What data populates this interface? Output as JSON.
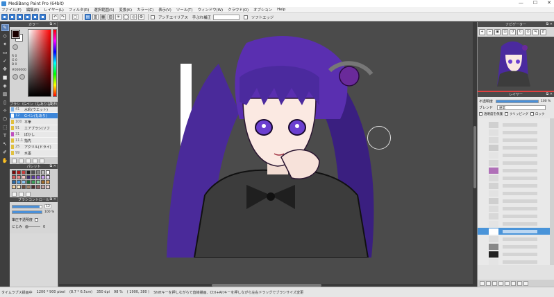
{
  "window": {
    "title": "MediBang Paint Pro (64bit)",
    "controls": [
      "—",
      "☐",
      "✕"
    ]
  },
  "menu": [
    "ファイル(F)",
    "編集(E)",
    "レイヤー(L)",
    "フィルタ(R)",
    "選択範囲(S)",
    "変換(K)",
    "カラー(C)",
    "表示(V)",
    "ツール(T)",
    "ウィンドウ(W)",
    "クラウド(O)",
    "オプション",
    "Help"
  ],
  "toolbar": {
    "antialias_label": "アンチエイリアス",
    "stabilizer_label": "手ぶれ補正",
    "soft_edge_label": "ソフトエッジ"
  },
  "panels": {
    "color_title": "カラー",
    "brush_title": "ブラシ（Gペン（もありもの））",
    "palette_title": "パレット",
    "brush_control_title": "ブラシコントロール",
    "navigator_title": "ナビゲーター",
    "layer_title": "レイヤー"
  },
  "color": {
    "fg": "#1a0000",
    "bg": "#ffffff",
    "rgb_lines": [
      "R 0",
      "G 0",
      "B 0"
    ],
    "hex": "#000000"
  },
  "brushes": [
    {
      "size": "41",
      "name": "水彩(ウエット)",
      "color": "#7fb2e5"
    },
    {
      "size": "12",
      "name": "Gペン(もあり)",
      "color": "#ffffff"
    },
    {
      "size": "100",
      "name": "平筆",
      "color": "#e0c040"
    },
    {
      "size": "91",
      "name": "エアブラシ(ソフ",
      "color": "#e0c040"
    },
    {
      "size": "31",
      "name": "ぼかし",
      "color": "#c050c0"
    },
    {
      "size": "11.1",
      "name": "指先",
      "color": "#e0c040"
    },
    {
      "size": "25",
      "name": "アクリル(ドライ)",
      "color": "#e0c040"
    },
    {
      "size": "99",
      "name": "水墨",
      "color": "#e0c040"
    }
  ],
  "palette": [
    "#7a0a0a",
    "#b01818",
    "#c83c3c",
    "#1e1e1e",
    "#505050",
    "#8a8a8a",
    "#bdbdbd",
    "#ffffff",
    "#d85a5a",
    "#e88a8a",
    "#f2c4c4",
    "#3a2a6a",
    "#5a3a9a",
    "#8a5ac8",
    "#c8a0f0",
    "#e8d8f8",
    "#2a6aa8",
    "#4a9ae0",
    "#8ac4f0",
    "#1e6a3a",
    "#3aa05a",
    "#8ad0a0",
    "#a06a2a",
    "#d8a060",
    "#f0d0a0",
    "#f8e8c8",
    "#6a4a3a",
    "#a0806a",
    "#503030",
    "#906060",
    "#c0a0a0",
    "#e8d0d0"
  ],
  "brush_control": {
    "size_value": "12",
    "opacity_value": "100 %",
    "size_fraction": 0.92,
    "opacity_fraction": 1.0,
    "pressure_opacity_label": "筆圧不透明度",
    "blur_label": "にじみ",
    "blur_value": "0"
  },
  "layer": {
    "opacity_label": "不透明度",
    "opacity_value": "100 %",
    "opacity_fraction": 1.0,
    "blend_label": "ブレンド",
    "blend_value": "通常",
    "protect_alpha_label": "透明度を保護",
    "clipping_label": "クリッピング",
    "lock_label": "ロック"
  },
  "layers": [
    {
      "thumb": "#d0d0d0",
      "selected": false
    },
    {
      "thumb": "#e0e0e0",
      "selected": false
    },
    {
      "thumb": "#dadada",
      "selected": false
    },
    {
      "thumb": "#cccccc",
      "selected": false
    },
    {
      "thumb": "#e4e4e4",
      "selected": false
    },
    {
      "thumb": "#d6d6d6",
      "selected": false
    },
    {
      "thumb": "#b070b8",
      "selected": false
    },
    {
      "thumb": "#dadada",
      "selected": false
    },
    {
      "thumb": "#d2d2d2",
      "selected": false
    },
    {
      "thumb": "#e2e2e2",
      "selected": false
    },
    {
      "thumb": "#cfcfcf",
      "selected": false
    },
    {
      "thumb": "#dcdcdc",
      "selected": false
    },
    {
      "thumb": "#d8d8d8",
      "selected": false
    },
    {
      "thumb": "#e4e4e4",
      "selected": false
    },
    {
      "thumb": "#ffffff",
      "selected": true
    },
    {
      "thumb": "#dcdcdc",
      "selected": false
    },
    {
      "thumb": "#888888",
      "selected": false
    },
    {
      "thumb": "#222222",
      "selected": false
    },
    {
      "thumb": "#e4e4e4",
      "selected": false
    }
  ],
  "status": {
    "mode": "タイムラプス録画中",
    "size": "1200 * 900 pixel",
    "dims": "(8.7 * 6.5cm)",
    "dpi": "350 dpi",
    "zoom": "98 %",
    "coords": "( 1900, 380 )",
    "hint": "Shiftキーを押しながらで直線描画、Ctrl+Altキーを押しながら左右ドラッグでブラシサイズ変更"
  }
}
